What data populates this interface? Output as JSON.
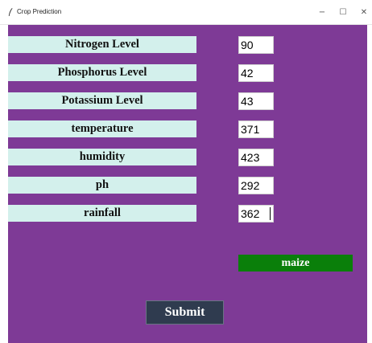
{
  "window": {
    "title": "Crop Prediction",
    "controls": {
      "minimize_glyph": "−",
      "maximize_glyph": "☐",
      "close_glyph": "✕"
    }
  },
  "fields": [
    {
      "label": "Nitrogen Level",
      "value": "90"
    },
    {
      "label": "Phosphorus Level",
      "value": "42"
    },
    {
      "label": "Potassium Level",
      "value": "43"
    },
    {
      "label": "temperature",
      "value": "371"
    },
    {
      "label": "humidity",
      "value": "423"
    },
    {
      "label": "ph",
      "value": "292"
    },
    {
      "label": "rainfall",
      "value": "362"
    }
  ],
  "result": {
    "text": "maize"
  },
  "submit": {
    "label": "Submit"
  },
  "colors": {
    "background": "#7e3a96",
    "label_background": "#d3f0ec",
    "result_background": "#0a7f0a",
    "button_background": "#2f3b4f"
  },
  "icons": {
    "app": "feather-icon"
  }
}
